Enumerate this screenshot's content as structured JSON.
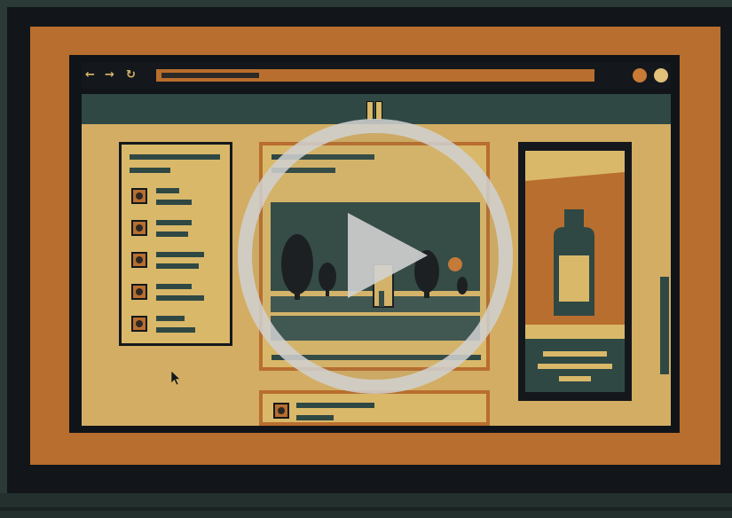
{
  "video": {
    "title": "",
    "state": "paused",
    "play_icon": "play-icon"
  },
  "illustration": {
    "subject": "",
    "browser": {
      "nav_icons": [
        "arrow-left-icon",
        "arrow-right-icon",
        "refresh-icon"
      ],
      "nav_glyphs": [
        "←",
        "→",
        "↻"
      ],
      "window_control_colors": [
        "#c97a35",
        "#e2c07a"
      ]
    },
    "sidebar_rows": 5,
    "colors": {
      "background": "#2b3a37",
      "frame": "#b86e2e",
      "bezel": "#12161a",
      "page": "#d2ad63",
      "header": "#2f4844",
      "accent": "#d9b869",
      "overlay": "#d2d2d2"
    }
  }
}
